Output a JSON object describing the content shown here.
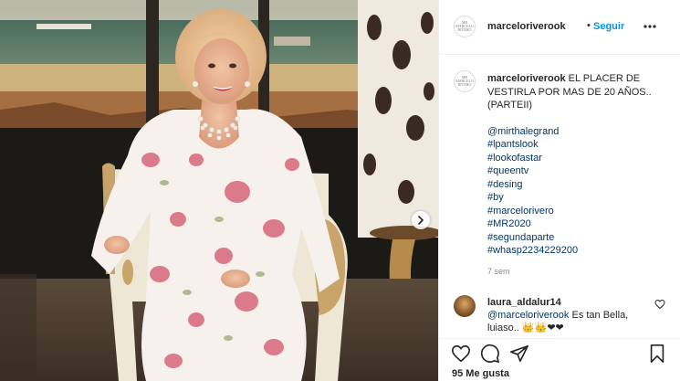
{
  "header": {
    "username": "marceloriverook",
    "separator": "•",
    "follow_label": "Seguir",
    "avatar_text": "MR MARCELO RIVERO"
  },
  "caption": {
    "username": "marceloriverook",
    "text": "EL PLACER DE VESTIRLA POR MAS DE 20 AÑOS.. (PARTEII)",
    "tags": [
      "@mirthalegrand",
      "#lpantslook",
      "#lookofastar",
      "#queentv",
      "#desing",
      "#by",
      "#marcelorivero",
      "#MR2020",
      "#segundaparte",
      "#whasp2234229200"
    ],
    "age": "7 sem"
  },
  "comment": {
    "username": "laura_aldalur14",
    "mention": "@marceloriverook",
    "text": "Es tan Bella, luiaso..",
    "emojis": "👑👑❤❤"
  },
  "likes": "95 Me gusta",
  "icons": {
    "more": "more-options-icon",
    "like": "heart-icon",
    "comment": "comment-icon",
    "share": "send-icon",
    "save": "bookmark-icon",
    "next": "chevron-right-icon"
  },
  "colors": {
    "link": "#00376b",
    "follow": "#0095f6",
    "muted": "#8e8e8e"
  }
}
